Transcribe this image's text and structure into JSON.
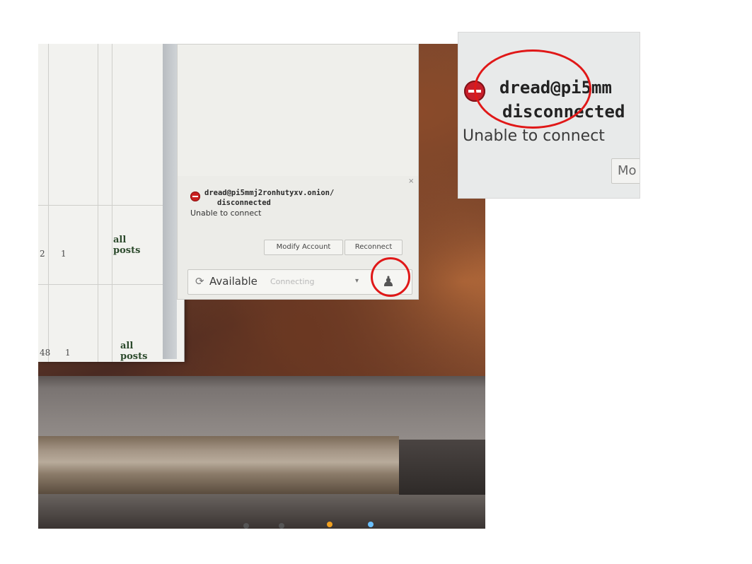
{
  "photo": {
    "table": {
      "rows": [
        {
          "col1": "2",
          "col2": "1",
          "col3_label_line1": "all",
          "col3_label_line2": "posts"
        },
        {
          "col1": "48",
          "col2": "1",
          "col3_label_line1": "all",
          "col3_label_line2": "posts"
        }
      ]
    },
    "notification": {
      "close_glyph": "×",
      "account": "dread@pi5mmj2ronhutyxv.onion/",
      "state": "disconnected",
      "message": "Unable to connect",
      "modify_button": "Modify Account",
      "reconnect_button": "Reconnect"
    },
    "status_bar": {
      "spinner_glyph": "⟳",
      "status": "Available",
      "sub_status": "Connecting",
      "dropdown_glyph": "▾",
      "buddy_glyph": "♟"
    },
    "annotation_color": "#e01818"
  },
  "inset": {
    "account_partial": "dread@pi5mm",
    "state": "disconnected",
    "message": "Unable to connect",
    "button_partial": "Mo"
  }
}
